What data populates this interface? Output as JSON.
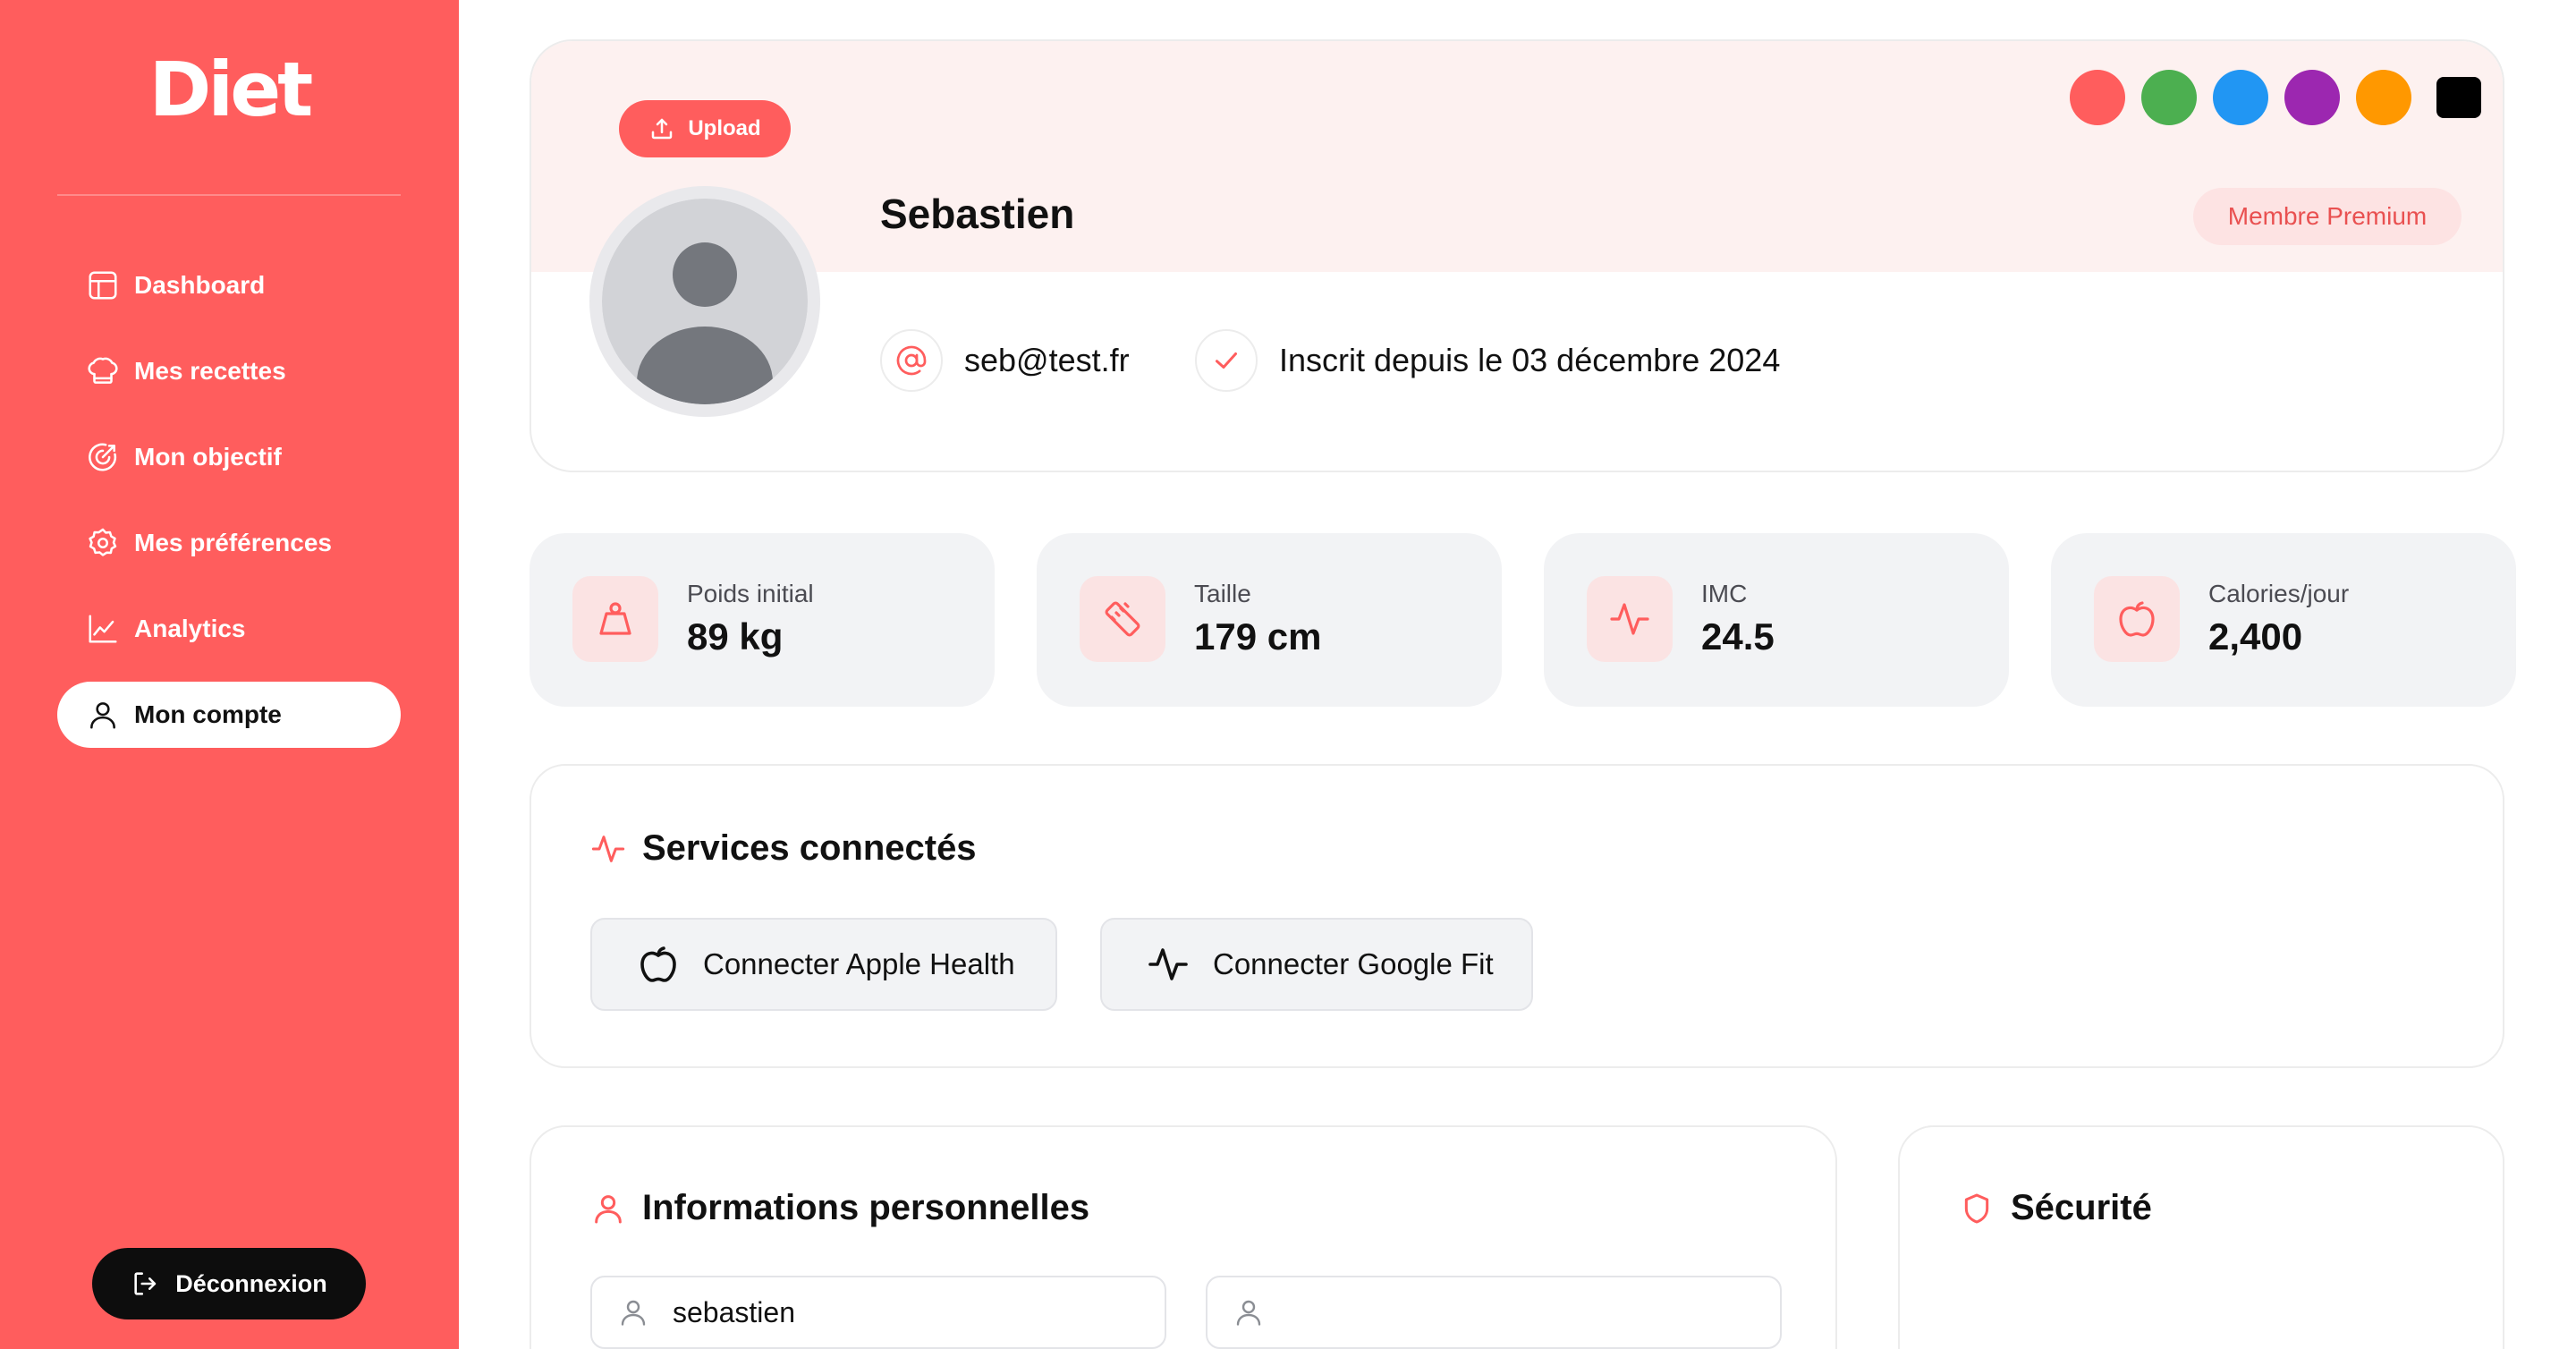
{
  "app": {
    "logo": "Diet"
  },
  "sidebar": {
    "items": [
      {
        "label": "Dashboard",
        "icon": "dashboard-icon"
      },
      {
        "label": "Mes recettes",
        "icon": "chef-hat-icon"
      },
      {
        "label": "Mon objectif",
        "icon": "target-icon"
      },
      {
        "label": "Mes préférences",
        "icon": "gear-icon"
      },
      {
        "label": "Analytics",
        "icon": "chart-line-icon"
      },
      {
        "label": "Mon compte",
        "icon": "user-icon",
        "active": true
      }
    ],
    "logout_label": "Déconnexion"
  },
  "profile": {
    "upload_label": "Upload",
    "name": "Sebastien",
    "badge": "Membre Premium",
    "email": "seb@test.fr",
    "member_since": "Inscrit depuis le 03 décembre 2024",
    "theme_colors": [
      "#ff5d5d",
      "#4caf50",
      "#2196f3",
      "#9c27b0",
      "#ff9800",
      "#000000"
    ]
  },
  "stats": [
    {
      "label": "Poids initial",
      "value": "89 kg",
      "icon": "weight-icon"
    },
    {
      "label": "Taille",
      "value": "179 cm",
      "icon": "ruler-icon"
    },
    {
      "label": "IMC",
      "value": "24.5",
      "icon": "activity-icon"
    },
    {
      "label": "Calories/jour",
      "value": "2,400",
      "icon": "apple-icon"
    }
  ],
  "services": {
    "title": "Services connectés",
    "apple_label": "Connecter Apple Health",
    "google_label": "Connecter Google Fit"
  },
  "personal": {
    "title": "Informations personnelles",
    "first_field_value": "sebastien",
    "second_field_value": ""
  },
  "security": {
    "title": "Sécurité"
  },
  "colors": {
    "accent": "#ff5d5d",
    "accent_soft": "#fbe3e3",
    "text": "#111111"
  }
}
